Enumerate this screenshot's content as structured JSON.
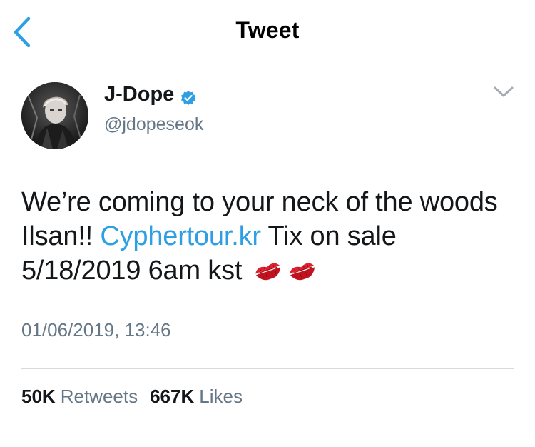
{
  "nav": {
    "title": "Tweet",
    "back_icon": "chevron-left-icon",
    "accent_color": "#2f9fe4"
  },
  "tweet": {
    "author_name": "J-Dope",
    "author_handle": "@jdopeseok",
    "verified": true,
    "text_before_link": "We’re coming to your neck of the woods Ilsan!! ",
    "link_text": "Cyphertour.kr",
    "text_after_link": " Tix on sale 5/18/2019 6am kst",
    "emojis": [
      "kiss-mark-icon",
      "kiss-mark-icon"
    ],
    "timestamp": "01/06/2019, 13:46"
  },
  "stats": {
    "retweets_count": "50K",
    "retweets_label": "Retweets",
    "likes_count": "667K",
    "likes_label": "Likes"
  }
}
